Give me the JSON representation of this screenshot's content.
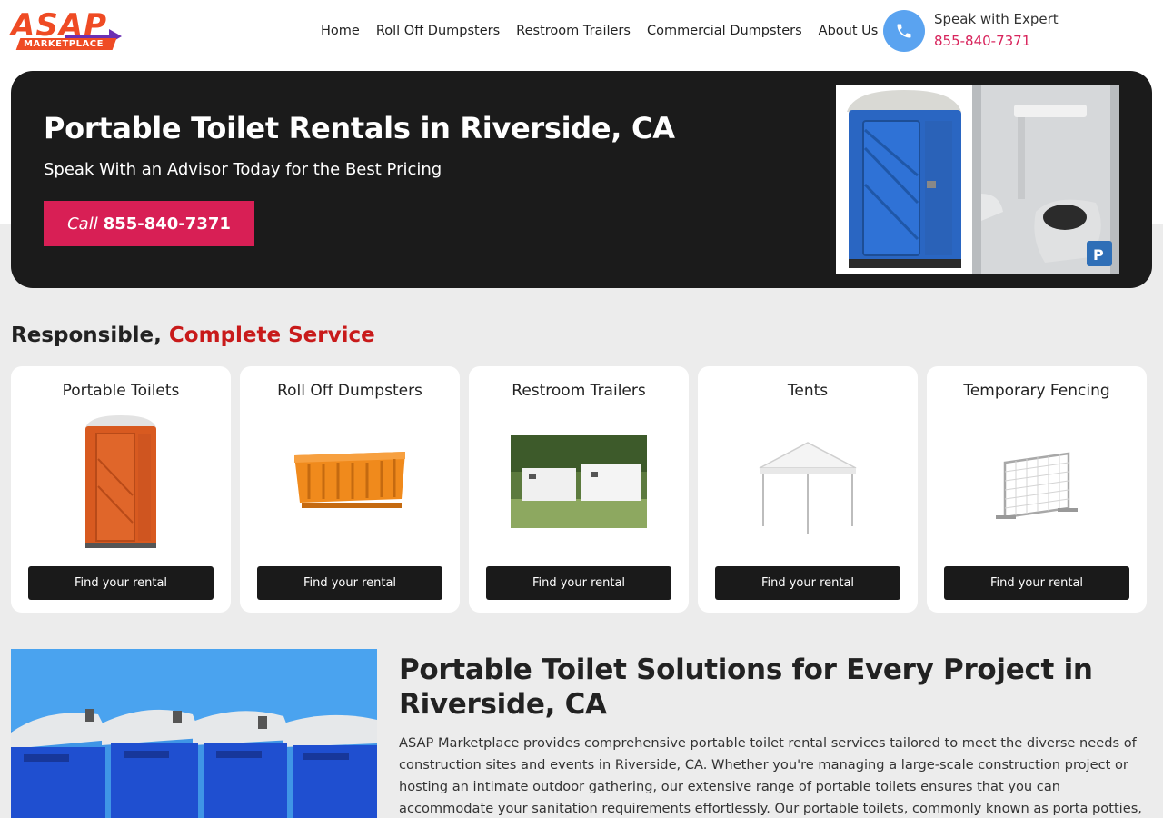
{
  "brand": {
    "logo_main": "ASAP",
    "logo_sub": "MARKETPLACE",
    "brand_color": "#ef4b24",
    "arrow_color": "#6b2fb3"
  },
  "nav": {
    "items": [
      {
        "label": "Home"
      },
      {
        "label": "Roll Off Dumpsters"
      },
      {
        "label": "Restroom Trailers"
      },
      {
        "label": "Commercial Dumpsters"
      },
      {
        "label": "About Us"
      }
    ]
  },
  "expert": {
    "label": "Speak with Expert",
    "phone": "855-840-7371",
    "icon": "phone-icon"
  },
  "hero": {
    "title": "Portable Toilet Rentals in Riverside, CA",
    "subtitle": "Speak With an Advisor Today for the Best Pricing",
    "cta_prefix": "Call",
    "cta_number": "855-840-7371",
    "cta_color": "#d81f55"
  },
  "services": {
    "title_main": "Responsible,",
    "title_accent": "Complete Service",
    "cards": [
      {
        "title": "Portable Toilets",
        "button": "Find your rental",
        "icon": "portable-toilet-image"
      },
      {
        "title": "Roll Off Dumpsters",
        "button": "Find your rental",
        "icon": "dumpster-image"
      },
      {
        "title": "Restroom Trailers",
        "button": "Find your rental",
        "icon": "restroom-trailer-image"
      },
      {
        "title": "Tents",
        "button": "Find your rental",
        "icon": "tent-image"
      },
      {
        "title": "Temporary Fencing",
        "button": "Find your rental",
        "icon": "fence-image"
      }
    ]
  },
  "content": {
    "title": "Portable Toilet Solutions for Every Project in Riverside, CA",
    "body": "ASAP Marketplace provides comprehensive portable toilet rental services tailored to meet the diverse needs of construction sites and events in Riverside, CA. Whether you're managing a large-scale construction project or hosting an intimate outdoor gathering, our extensive range of portable toilets ensures that you can accommodate your sanitation requirements effortlessly. Our portable toilets, commonly known as porta potties, are designed for"
  }
}
